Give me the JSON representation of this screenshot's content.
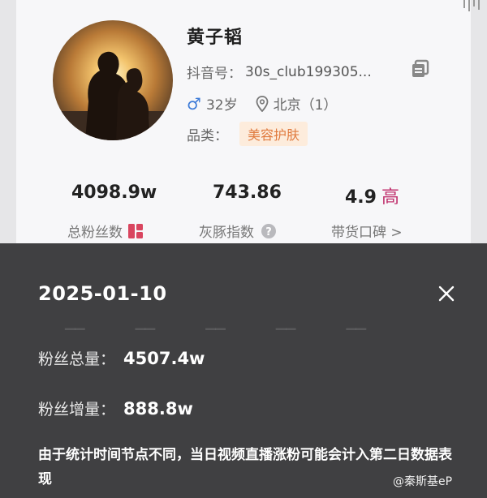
{
  "profile": {
    "name": "黄子韬",
    "id_label": "抖音号：",
    "id_value": "30s_club199305...",
    "age": "32岁",
    "location": "北京（1）",
    "category_label": "品类：",
    "category": "美容护肤"
  },
  "stats": [
    {
      "value": "4098.9w",
      "label": "总粉丝数"
    },
    {
      "value": "743.86",
      "label": "灰豚指数"
    },
    {
      "value": "4.9",
      "extra": "高",
      "label": "带货口碑 >"
    }
  ],
  "popup": {
    "date": "2025-01-10",
    "total_label": "粉丝总量：",
    "total_value": "4507.4w",
    "growth_label": "粉丝增量：",
    "growth_value": "888.8w",
    "note": "由于统计时间节点不同，当日视频直播涨粉可能会计入第二日数据表现"
  },
  "watermark": "@秦斯基eP",
  "icons": {
    "gender": "male-icon",
    "location": "location-pin-icon",
    "copy": "copy-icon",
    "close": "close-icon"
  },
  "colors": {
    "accent_badge_bg": "#fdecdc",
    "accent_badge_text": "#e07a3e",
    "high_text": "#c0326e",
    "male_icon": "#3d7bd8"
  }
}
